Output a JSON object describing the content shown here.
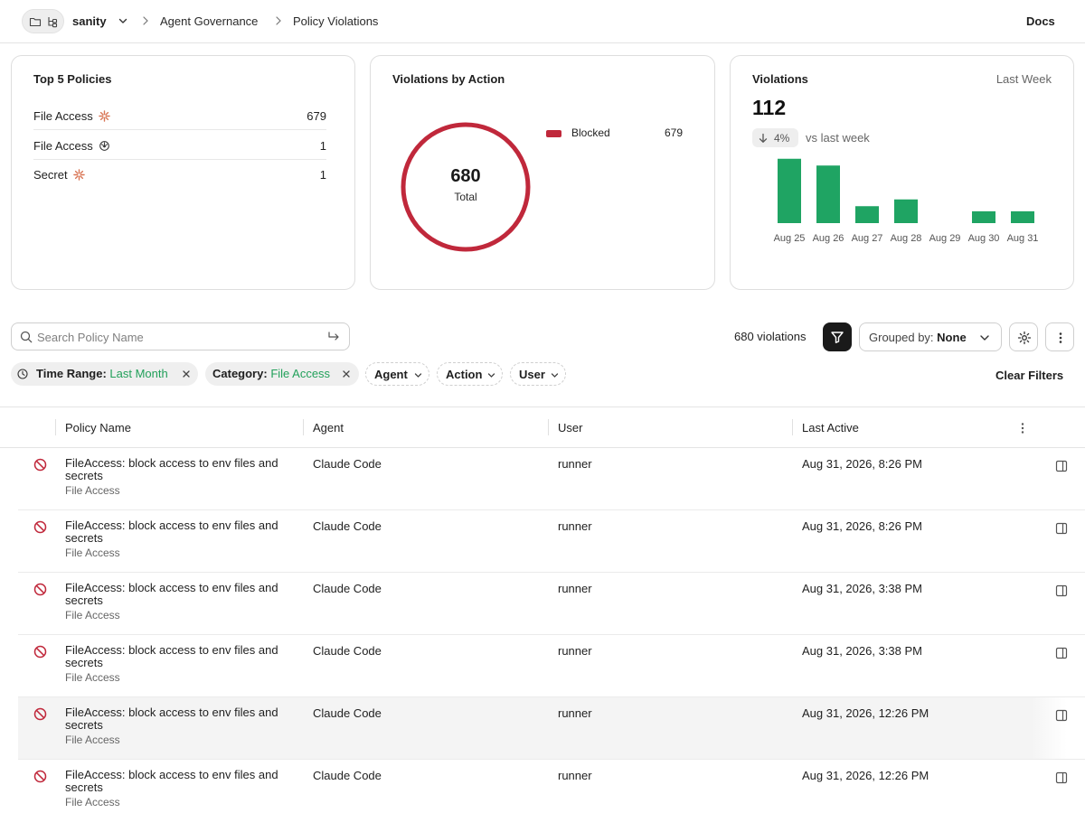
{
  "header": {
    "workspace": "sanity",
    "breadcrumbs": [
      "Agent Governance",
      "Policy Violations"
    ],
    "docs_label": "Docs"
  },
  "top_policies": {
    "title": "Top 5 Policies",
    "items": [
      {
        "name": "File Access",
        "icon": "claude-burst-icon",
        "count": "679"
      },
      {
        "name": "File Access",
        "icon": "openai-knot-icon",
        "count": "1"
      },
      {
        "name": "Secret",
        "icon": "claude-burst-icon",
        "count": "1"
      }
    ]
  },
  "violations_by_action": {
    "title": "Violations by Action",
    "total_value": "680",
    "total_label": "Total",
    "legend": [
      {
        "name": "Blocked",
        "value": "679",
        "color": "#c0283b"
      }
    ]
  },
  "violations": {
    "title": "Violations",
    "period": "Last Week",
    "count": "112",
    "trend_value": "4%",
    "trend_direction": "down",
    "trend_text": "vs last week",
    "bar_color": "#1fa463"
  },
  "chart_data": {
    "type": "bar",
    "categories": [
      "Aug 25",
      "Aug 26",
      "Aug 27",
      "Aug 28",
      "Aug 29",
      "Aug 30",
      "Aug 31"
    ],
    "values": [
      38,
      34,
      10,
      14,
      0,
      7,
      7
    ],
    "ylim": [
      0,
      40
    ]
  },
  "toolbar": {
    "search_placeholder": "Search Policy Name",
    "violation_count": "680 violations",
    "grouped_label": "Grouped by:",
    "grouped_value": "None"
  },
  "filters": {
    "chips": [
      {
        "label": "Time Range:",
        "value": "Last Month"
      },
      {
        "label": "Category:",
        "value": "File Access"
      }
    ],
    "dropdowns": [
      "Agent",
      "Action",
      "User"
    ],
    "clear_label": "Clear Filters"
  },
  "table": {
    "columns": [
      "Policy Name",
      "Agent",
      "User",
      "Last Active"
    ],
    "rows": [
      {
        "title": "FileAccess: block access to env files and secrets",
        "category": "File Access",
        "agent": "Claude Code",
        "user": "runner",
        "last_active": "Aug 31, 2026, 8:26 PM"
      },
      {
        "title": "FileAccess: block access to env files and secrets",
        "category": "File Access",
        "agent": "Claude Code",
        "user": "runner",
        "last_active": "Aug 31, 2026, 8:26 PM"
      },
      {
        "title": "FileAccess: block access to env files and secrets",
        "category": "File Access",
        "agent": "Claude Code",
        "user": "runner",
        "last_active": "Aug 31, 2026, 3:38 PM"
      },
      {
        "title": "FileAccess: block access to env files and secrets",
        "category": "File Access",
        "agent": "Claude Code",
        "user": "runner",
        "last_active": "Aug 31, 2026, 3:38 PM"
      },
      {
        "title": "FileAccess: block access to env files and secrets",
        "category": "File Access",
        "agent": "Claude Code",
        "user": "runner",
        "last_active": "Aug 31, 2026, 12:26 PM"
      },
      {
        "title": "FileAccess: block access to env files and secrets",
        "category": "File Access",
        "agent": "Claude Code",
        "user": "runner",
        "last_active": "Aug 31, 2026, 12:26 PM"
      }
    ]
  }
}
